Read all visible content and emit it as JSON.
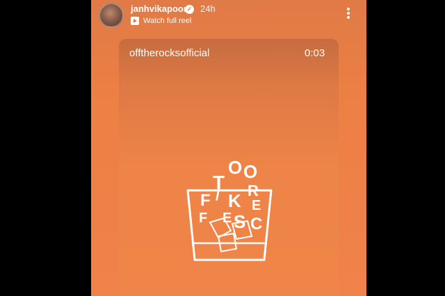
{
  "header": {
    "username": "janhvikapoor",
    "time": "24h",
    "watch_label": "Watch full reel"
  },
  "card": {
    "username": "offtherocksofficial",
    "timestamp": "0:03"
  },
  "icons": {
    "verified": "verified-badge-icon",
    "play": "play-icon",
    "more": "more-options-icon"
  },
  "colors": {
    "background": "#ed8044",
    "text": "#ffffff"
  }
}
